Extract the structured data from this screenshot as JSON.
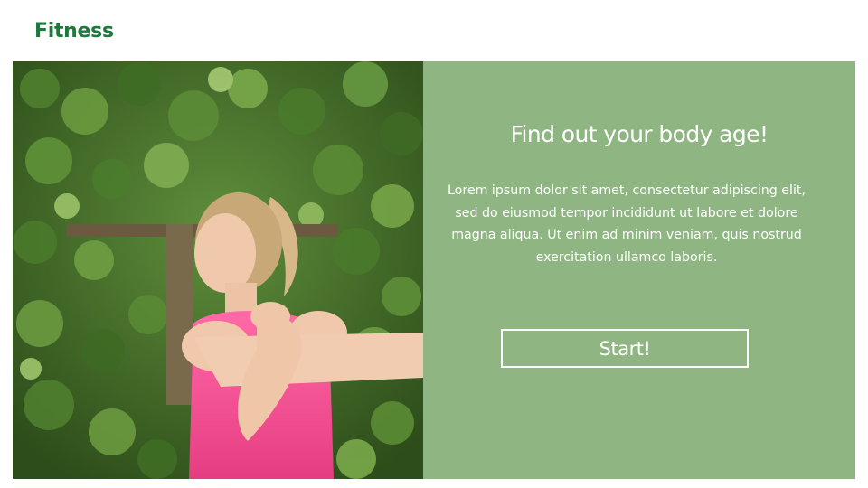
{
  "header": {
    "brand": "Fitness"
  },
  "hero": {
    "title": "Find out your body age!",
    "description": "Lorem ipsum dolor sit amet, consectetur adipiscing elit, sed do eiusmod tempor incididunt ut labore et dolore magna aliqua. Ut enim ad minim veniam, quis nostrud exercitation ullamco laboris.",
    "start_label": "Start!",
    "photo_subject": "woman-stretching-arm-photo"
  },
  "colors": {
    "brand": "#1e7a3c",
    "panel_background": "#8fb682",
    "panel_text": "#ffffff",
    "page_background": "#ffffff"
  }
}
